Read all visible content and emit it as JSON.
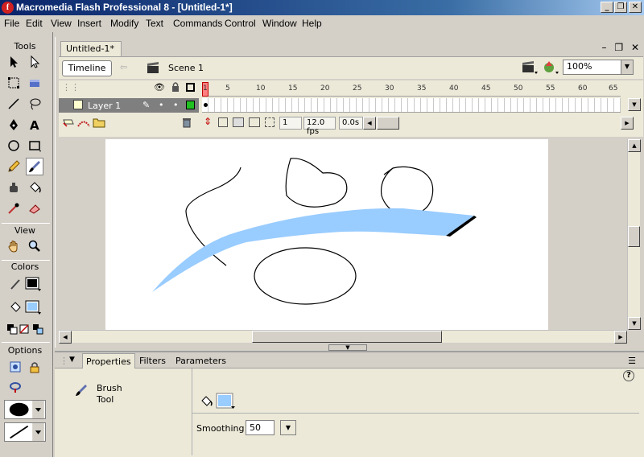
{
  "window": {
    "title": "Macromedia Flash Professional 8 - [Untitled-1*]",
    "app_icon": "f"
  },
  "menu": [
    "File",
    "Edit",
    "View",
    "Insert",
    "Modify",
    "Text",
    "Commands",
    "Control",
    "Window",
    "Help"
  ],
  "tools": {
    "header": "Tools",
    "view_header": "View",
    "colors_header": "Colors",
    "options_header": "Options"
  },
  "document": {
    "tab_title": "Untitled-1*",
    "timeline_button": "Timeline",
    "scene": "Scene 1",
    "zoom": "100%"
  },
  "timeline": {
    "ruler": [
      "1",
      "5",
      "10",
      "15",
      "20",
      "25",
      "30",
      "35",
      "40",
      "45",
      "50",
      "55",
      "60",
      "65"
    ],
    "layer_name": "Layer 1",
    "current_frame": "1",
    "fps": "12.0 fps",
    "elapsed": "0.0s"
  },
  "properties": {
    "tabs": [
      "Properties",
      "Filters",
      "Parameters"
    ],
    "tool_name_line1": "Brush",
    "tool_name_line2": "Tool",
    "smoothing_label": "Smoothing",
    "smoothing_value": "50",
    "help": "?"
  },
  "colors": {
    "fill": "#99ccff",
    "stroke": "#000000",
    "title_start": "#0a246a",
    "title_end": "#a6caf0"
  }
}
